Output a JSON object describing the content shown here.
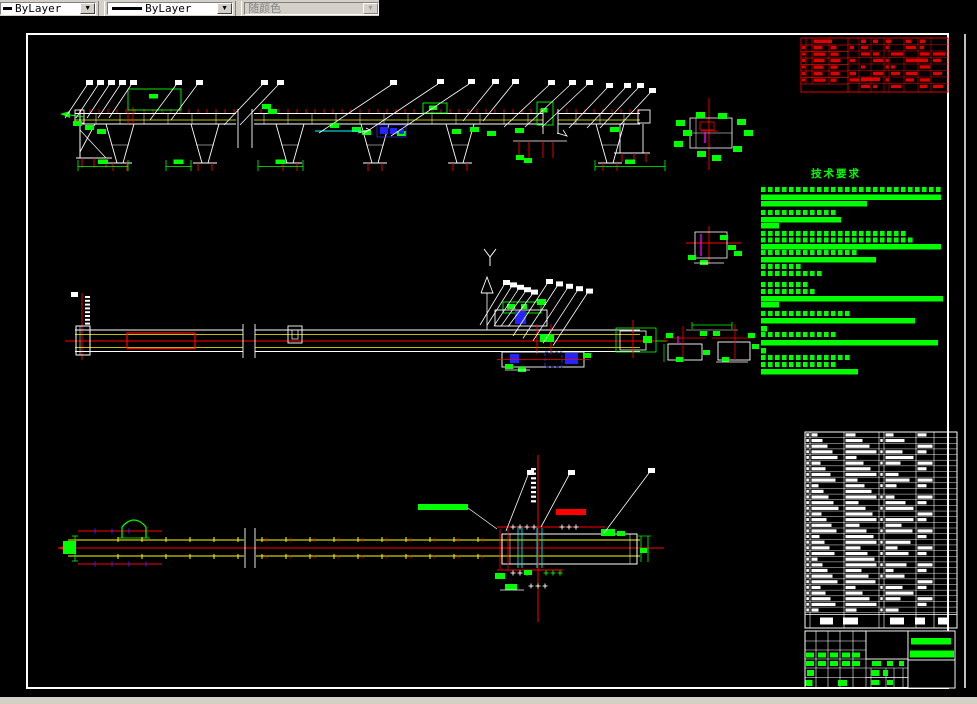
{
  "toolbar": {
    "color_control": {
      "value": "ByLayer"
    },
    "linetype_control": {
      "value": "ByLayer"
    },
    "plot_style_control": {
      "value": "随颜色"
    }
  },
  "drawing": {
    "notes_title": "技术要求"
  }
}
